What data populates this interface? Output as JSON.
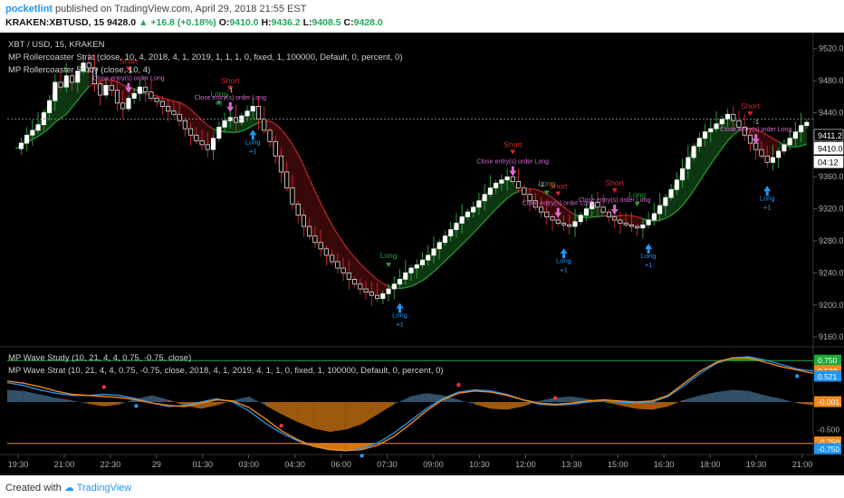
{
  "header": {
    "author": "pocketlint",
    "published_text": "published on TradingView.com, April 29, 2018 21:55 EST",
    "symbol": "KRAKEN:XBTUSD, 15",
    "last": "9428.0",
    "change": "+16.8 (+0.18%)",
    "open_label": "O:",
    "open": "9410.0",
    "high_label": "H:",
    "high": "9436.2",
    "low_label": "L:",
    "low": "9408.5",
    "close_label": "C:",
    "close": "9428.0"
  },
  "overlays": {
    "main_title": "XBT / USD, 15, KRAKEN",
    "strategy": "MP Rollercoaster Strat (close, 10, 4, 2018, 4, 1, 2019, 1, 1, 1, 0, fixed, 1, 100000, Default, 0, percent, 0)",
    "study": "MP Rollercoaster Study (close, 10, 4)",
    "wave_study": "MP Wave Study (10, 21, 4, 4, 0.75, -0.75, close)",
    "wave_strat": "MP Wave Strat (10, 21, 4, 4, 0.75, -0.75, close, 2018, 4, 1, 2019, 4, 1, 1, 0, fixed, 1, 100000, Default, 0, percent, 0)"
  },
  "footer": {
    "created_with": "Created with",
    "brand": "TradingView"
  },
  "colors": {
    "bull_candle": "#ffffff",
    "bear_candle": "#000000",
    "green_wick": "#2e9e3a",
    "red_wick": "#c0282d",
    "green_fill": "#0e3a12",
    "red_fill": "#3c0a0a",
    "long_label": "#2e9e3a",
    "short_label": "#d7262b",
    "close_label": "#d36cd0",
    "entry_arrow": "#2196f3",
    "wave_blue": "#2a8fdd",
    "wave_orange": "#f08a1c",
    "hist_blue": "#3b5f7a",
    "hist_orange": "#b86a12"
  },
  "chart_data": [
    {
      "type": "candlestick",
      "title": "XBT / USD, 15, KRAKEN",
      "ylim": [
        9150,
        9540
      ],
      "y_ticks": [
        9160.0,
        9200.0,
        9240.0,
        9280.0,
        9320.0,
        9360.0,
        9400.0,
        9440.0,
        9480.0,
        9520.0
      ],
      "x_ticks": [
        "19:30",
        "21:00",
        "22:30",
        "29",
        "01:30",
        "03:00",
        "04:30",
        "06:00",
        "07:30",
        "09:00",
        "10:30",
        "12:00",
        "13:30",
        "15:00",
        "16:30",
        "18:00",
        "19:30",
        "21:00"
      ],
      "price_labels": [
        {
          "text": "9411.2"
        },
        {
          "text": "9410.0"
        },
        {
          "text": "04:12"
        }
      ],
      "close_series": [
        9395,
        9402,
        9412,
        9418,
        9425,
        9440,
        9455,
        9478,
        9472,
        9486,
        9478,
        9492,
        9502,
        9496,
        9476,
        9462,
        9474,
        9468,
        9452,
        9445,
        9458,
        9464,
        9472,
        9466,
        9458,
        9454,
        9448,
        9442,
        9438,
        9430,
        9420,
        9412,
        9405,
        9400,
        9394,
        9408,
        9422,
        9430,
        9434,
        9428,
        9436,
        9442,
        9448,
        9432,
        9418,
        9404,
        9386,
        9366,
        9346,
        9326,
        9312,
        9298,
        9286,
        9278,
        9270,
        9262,
        9254,
        9246,
        9240,
        9232,
        9226,
        9220,
        9216,
        9212,
        9208,
        9214,
        9220,
        9226,
        9232,
        9240,
        9246,
        9250,
        9256,
        9262,
        9270,
        9278,
        9286,
        9294,
        9302,
        9310,
        9316,
        9322,
        9330,
        9338,
        9346,
        9352,
        9356,
        9360,
        9354,
        9346,
        9338,
        9330,
        9322,
        9316,
        9310,
        9306,
        9302,
        9300,
        9298,
        9304,
        9312,
        9320,
        9328,
        9322,
        9316,
        9310,
        9306,
        9302,
        9300,
        9298,
        9296,
        9300,
        9306,
        9314,
        9324,
        9334,
        9344,
        9356,
        9370,
        9384,
        9398,
        9408,
        9416,
        9420,
        9426,
        9432,
        9438,
        9430,
        9422,
        9412,
        9402,
        9394,
        9386,
        9378,
        9384,
        9392,
        9400,
        9408,
        9416,
        9424,
        9428
      ],
      "trades": [
        {
          "text": "Short",
          "kind": "short",
          "i": 20
        },
        {
          "text": "-1",
          "kind": "short_qty",
          "i": 20
        },
        {
          "text": "Close entry(s) order Long",
          "kind": "close",
          "i": 20
        },
        {
          "text": "Long",
          "kind": "long",
          "i": 36
        },
        {
          "text": "Short",
          "kind": "short",
          "i": 38
        },
        {
          "text": "-1",
          "kind": "short_qty",
          "i": 38
        },
        {
          "text": "+1",
          "kind": "long_qty",
          "i": 36
        },
        {
          "text": "Close entry(s) order Long",
          "kind": "close",
          "i": 38
        },
        {
          "text": "Long",
          "kind": "long_entry",
          "i": 42
        },
        {
          "text": "+1",
          "kind": "long_entry_qty",
          "i": 42
        },
        {
          "text": "Long",
          "kind": "long",
          "i": 66
        },
        {
          "text": "Long",
          "kind": "long_entry",
          "i": 68
        },
        {
          "text": "+1",
          "kind": "long_entry_qty",
          "i": 68
        },
        {
          "text": "Short",
          "kind": "short",
          "i": 88
        },
        {
          "text": "Close entry(s) order Long",
          "kind": "close",
          "i": 88
        },
        {
          "text": "-1",
          "kind": "short_qty",
          "i": 93
        },
        {
          "text": "Close entry(s) order Long",
          "kind": "close",
          "i": 96
        },
        {
          "text": "Long",
          "kind": "long",
          "i": 94
        },
        {
          "text": "Short",
          "kind": "short",
          "i": 96
        },
        {
          "text": "Long",
          "kind": "long_entry",
          "i": 97
        },
        {
          "text": "+1",
          "kind": "long_entry_qty",
          "i": 97
        },
        {
          "text": "Short",
          "kind": "short",
          "i": 106
        },
        {
          "text": "Close entry(s) order Long",
          "kind": "close",
          "i": 106
        },
        {
          "text": "Long",
          "kind": "long",
          "i": 110
        },
        {
          "text": "Long",
          "kind": "long_entry",
          "i": 112
        },
        {
          "text": "+1",
          "kind": "long_entry_qty",
          "i": 112
        },
        {
          "text": "-1",
          "kind": "short_qty",
          "i": 131
        },
        {
          "text": "Close entry(s) order Long",
          "kind": "close",
          "i": 131
        },
        {
          "text": "Short",
          "kind": "short",
          "i": 130
        },
        {
          "text": "Long",
          "kind": "long_entry",
          "i": 133
        },
        {
          "text": "+1",
          "kind": "long_entry_qty",
          "i": 133
        }
      ]
    },
    {
      "type": "line",
      "title": "MP Wave Study (10, 21, 4, 4, 0.75, -0.75, close)",
      "ylim": [
        -0.95,
        0.95
      ],
      "levels": [
        0.75,
        -0.75
      ],
      "value_labels": [
        {
          "text": "0.750",
          "value": 0.75,
          "color": "#22a83a"
        },
        {
          "text": "0.522",
          "value": 0.56,
          "color": "#f08a1c"
        },
        {
          "text": "0.521",
          "value": 0.46,
          "color": "#2196f3"
        },
        {
          "text": "-0.001",
          "value": -0.001,
          "color": "#f08a1c"
        },
        {
          "text": "-0.500",
          "value": -0.5,
          "color": "none"
        },
        {
          "text": "-0.750",
          "value": -0.73,
          "color": "#f08a1c"
        },
        {
          "text": "-0.750",
          "value": -0.85,
          "color": "#2196f3"
        }
      ],
      "series": [
        {
          "values": [
            0.35,
            0.3,
            0.22,
            0.16,
            0.12,
            0.12,
            0.14,
            0.12,
            0.06,
            -0.02,
            -0.08,
            -0.06,
            0.0,
            0.06,
            0.0,
            -0.16,
            -0.38,
            -0.56,
            -0.7,
            -0.8,
            -0.86,
            -0.88,
            -0.84,
            -0.74,
            -0.56,
            -0.34,
            -0.12,
            0.06,
            0.18,
            0.22,
            0.2,
            0.14,
            0.04,
            -0.04,
            -0.06,
            -0.04,
            0.0,
            0.02,
            0.0,
            -0.02,
            0.0,
            0.1,
            0.3,
            0.52,
            0.7,
            0.8,
            0.82,
            0.76,
            0.68,
            0.6,
            0.56
          ]
        },
        {
          "values": [
            0.38,
            0.34,
            0.28,
            0.2,
            0.14,
            0.12,
            0.1,
            0.08,
            0.04,
            -0.02,
            -0.06,
            -0.08,
            -0.02,
            0.04,
            0.02,
            -0.1,
            -0.3,
            -0.52,
            -0.68,
            -0.8,
            -0.86,
            -0.88,
            -0.86,
            -0.78,
            -0.62,
            -0.4,
            -0.16,
            0.04,
            0.16,
            0.2,
            0.18,
            0.12,
            0.04,
            -0.02,
            -0.04,
            -0.02,
            0.02,
            0.04,
            0.02,
            0.0,
            0.02,
            0.12,
            0.34,
            0.56,
            0.72,
            0.8,
            0.8,
            0.72,
            0.64,
            0.58,
            0.52
          ]
        }
      ],
      "histogram": [
        0.22,
        0.2,
        0.14,
        0.08,
        0.03,
        -0.03,
        -0.08,
        -0.04,
        0.06,
        0.12,
        0.04,
        -0.06,
        -0.12,
        -0.06,
        0.03,
        0.1,
        -0.06,
        -0.22,
        -0.36,
        -0.48,
        -0.54,
        -0.5,
        -0.4,
        -0.22,
        -0.04,
        0.1,
        0.16,
        0.12,
        0.04,
        -0.04,
        -0.12,
        -0.14,
        -0.08,
        0.02,
        0.08,
        0.1,
        0.06,
        0.0,
        -0.06,
        -0.12,
        -0.14,
        -0.08,
        0.04,
        0.12,
        0.18,
        0.22,
        0.2,
        0.12,
        0.06,
        -0.02,
        -0.06
      ],
      "markers": [
        {
          "i": 6,
          "kind": "up"
        },
        {
          "i": 8,
          "kind": "down"
        },
        {
          "i": 17,
          "kind": "up"
        },
        {
          "i": 22,
          "kind": "down"
        },
        {
          "i": 28,
          "kind": "up"
        },
        {
          "i": 34,
          "kind": "up"
        },
        {
          "i": 49,
          "kind": "down"
        }
      ]
    }
  ]
}
